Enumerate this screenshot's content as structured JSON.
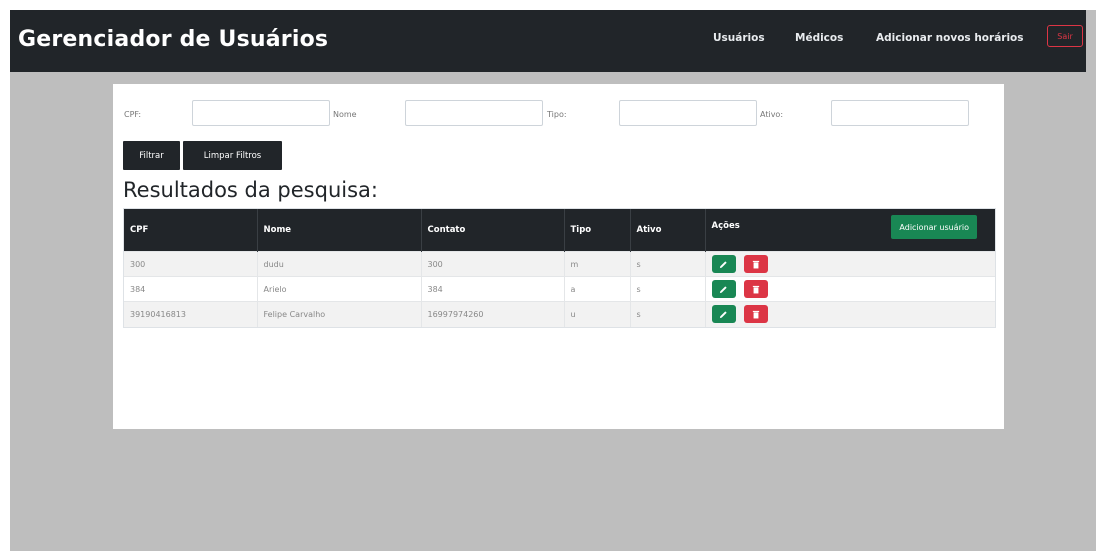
{
  "navbar": {
    "brand": "Gerenciador de Usuários",
    "links": [
      "Usuários",
      "Médicos",
      "Adicionar novos horários"
    ],
    "logout_label": "Sair"
  },
  "filters": {
    "labels": [
      "CPF:",
      "Nome",
      "Tipo:",
      "Ativo:"
    ],
    "values": [
      "",
      "",
      "",
      ""
    ],
    "filter_button": "Filtrar",
    "clear_button": "Limpar Filtros"
  },
  "results": {
    "title": "Resultados da pesquisa:",
    "columns": [
      "CPF",
      "Nome",
      "Contato",
      "Tipo",
      "Ativo",
      "Ações"
    ],
    "add_user_button": "Adicionar usuário",
    "rows": [
      [
        "300",
        "dudu",
        "300",
        "m",
        "s"
      ],
      [
        "384",
        "Arielo",
        "384",
        "a",
        "s"
      ],
      [
        "39190416813",
        "Felipe Carvalho",
        "16997974260",
        "u",
        "s"
      ]
    ]
  },
  "colors": {
    "navbar": "#212529",
    "success": "#198754",
    "danger": "#dc3545",
    "background": "#bebebe"
  },
  "icons": {
    "edit": "pencil-icon",
    "delete": "trash-icon"
  }
}
